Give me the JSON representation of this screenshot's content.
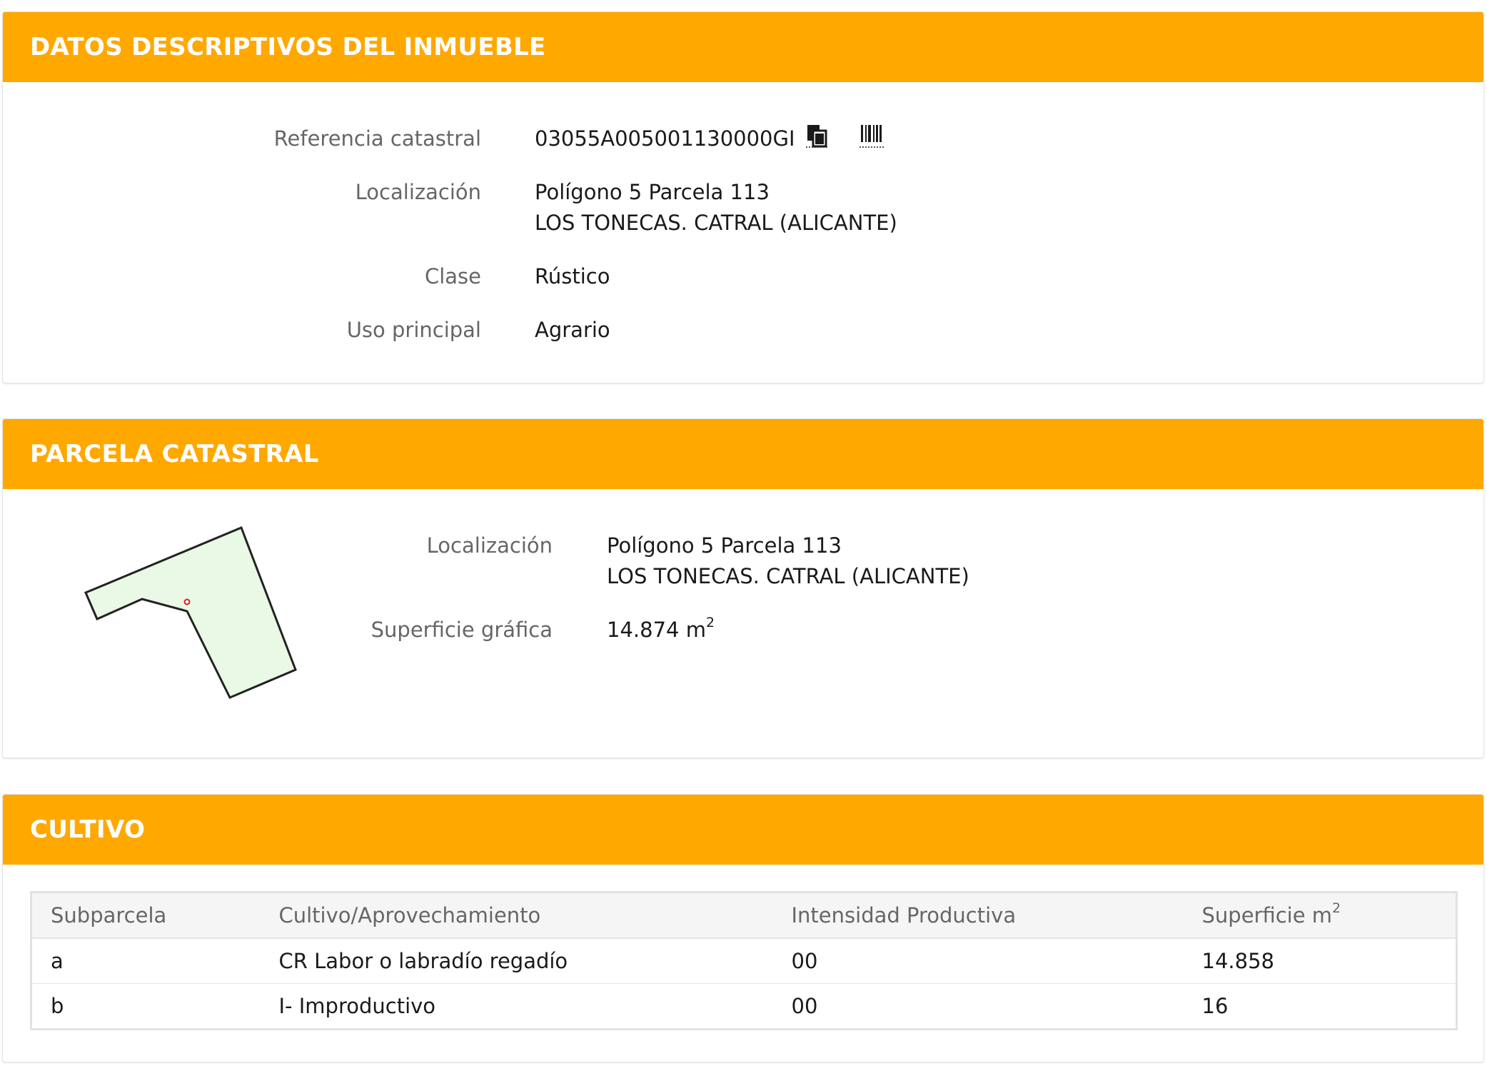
{
  "datos": {
    "title": "DATOS DESCRIPTIVOS DEL INMUEBLE",
    "referencia_label": "Referencia catastral",
    "referencia_value": "03055A005001130000GI",
    "localizacion_label": "Localización",
    "localizacion_line1": "Polígono 5 Parcela 113",
    "localizacion_line2": "LOS TONECAS. CATRAL (ALICANTE)",
    "clase_label": "Clase",
    "clase_value": "Rústico",
    "uso_label": "Uso principal",
    "uso_value": "Agrario",
    "icons": [
      "copy-icon",
      "barcode-icon"
    ]
  },
  "parcela": {
    "title": "PARCELA CATASTRAL",
    "localizacion_label": "Localización",
    "localizacion_line1": "Polígono 5 Parcela 113",
    "localizacion_line2": "LOS TONECAS. CATRAL (ALICANTE)",
    "superficie_label": "Superficie gráfica",
    "superficie_value": "14.874 m",
    "superficie_sup": "2",
    "map_fill_color": "#eaf8e6",
    "map_stroke_color": "#222222",
    "marker_color": "#e02020"
  },
  "cultivo": {
    "title": "CULTIVO",
    "headers": [
      "Subparcela",
      "Cultivo/Aprovechamiento",
      "Intensidad Productiva",
      "Superficie m"
    ],
    "header_sup": "2",
    "rows": [
      [
        "a",
        "CR Labor o labradío regadío",
        "00",
        "14.858"
      ],
      [
        "b",
        "I- Improductivo",
        "00",
        "16"
      ]
    ]
  },
  "colors": {
    "header_bg": "#FFA800",
    "header_text": "#ffffff",
    "label_text": "#666666",
    "value_text": "#1a1a1a"
  }
}
